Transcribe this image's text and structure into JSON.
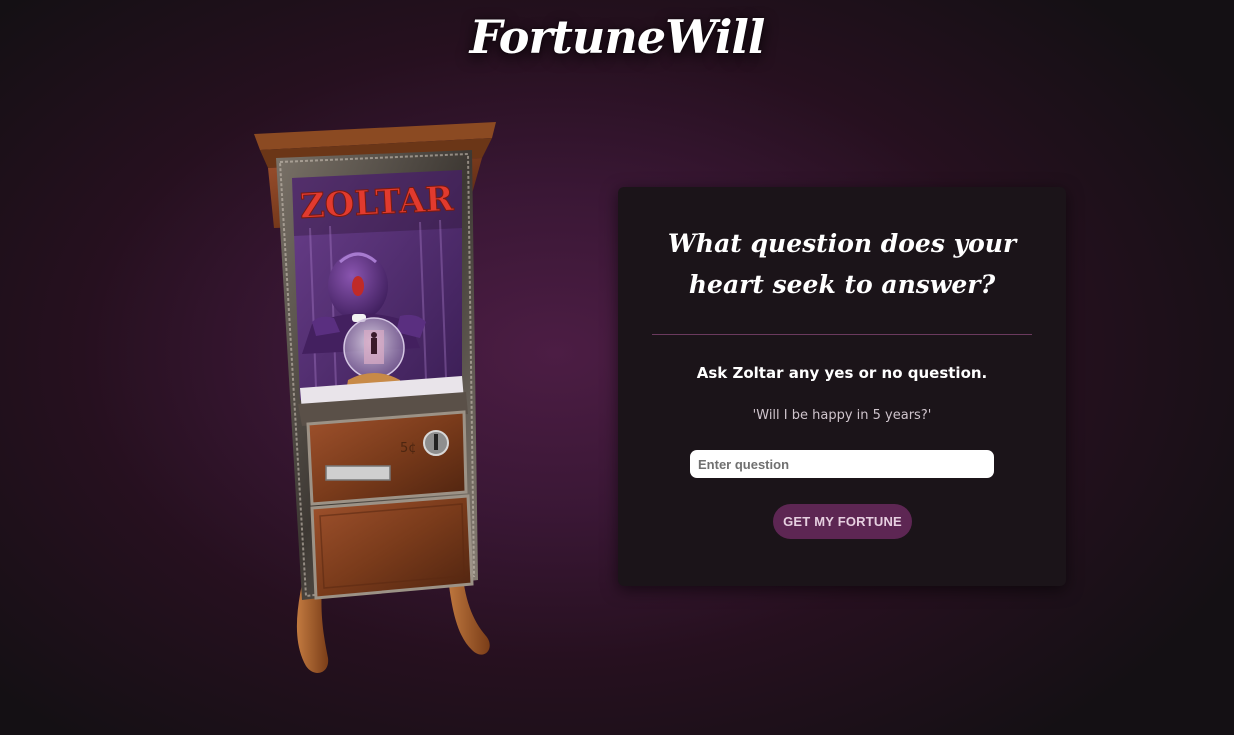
{
  "header": {
    "logo_text": "FortuneWill"
  },
  "machine": {
    "sign_text": "ZOLTAR",
    "coin_label": "5¢"
  },
  "card": {
    "title": "What question does your heart seek to answer?",
    "instruction": "Ask Zoltar any yes or no question.",
    "example": "'Will I be happy in 5 years?'",
    "input_placeholder": "Enter question",
    "input_value": "",
    "button_label": "GET MY FORTUNE"
  },
  "colors": {
    "background": "#3a1735",
    "card_background": "#1b1419",
    "divider": "#6b3a5e",
    "button": "#5d2653",
    "button_text": "#e6cfe0",
    "sign_red": "#e23a2e"
  }
}
